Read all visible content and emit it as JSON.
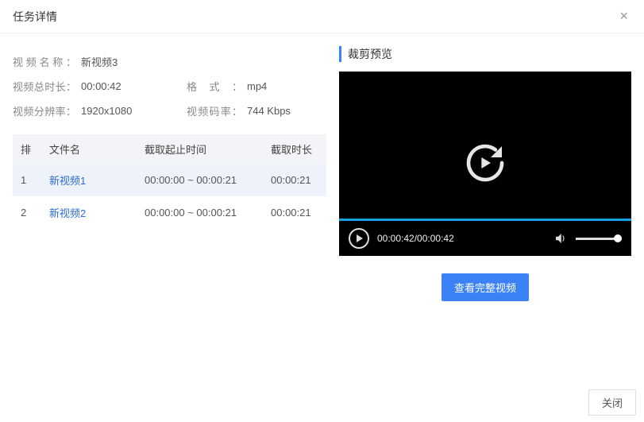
{
  "modal": {
    "title": "任务详情",
    "close_btn": "关闭"
  },
  "meta": {
    "name_label": "视频名称：",
    "name_value": "新视频3",
    "duration_label": "视频总时长：",
    "duration_value": "00:00:42",
    "format_label": "格式：",
    "format_value": "mp4",
    "resolution_label": "视频分辨率：",
    "resolution_value": "1920x1080",
    "bitrate_label": "视频码率：",
    "bitrate_value": "744 Kbps"
  },
  "table": {
    "headers": {
      "idx": "排",
      "name": "文件名",
      "range": "截取起止时间",
      "len": "截取时长"
    },
    "rows": [
      {
        "idx": "1",
        "name": "新视频1",
        "range": "00:00:00 ~ 00:00:21",
        "len": "00:00:21"
      },
      {
        "idx": "2",
        "name": "新视频2",
        "range": "00:00:00 ~ 00:00:21",
        "len": "00:00:21"
      }
    ]
  },
  "preview": {
    "title": "裁剪预览",
    "time_display": "00:00:42/00:00:42",
    "view_full_btn": "查看完整视频"
  }
}
